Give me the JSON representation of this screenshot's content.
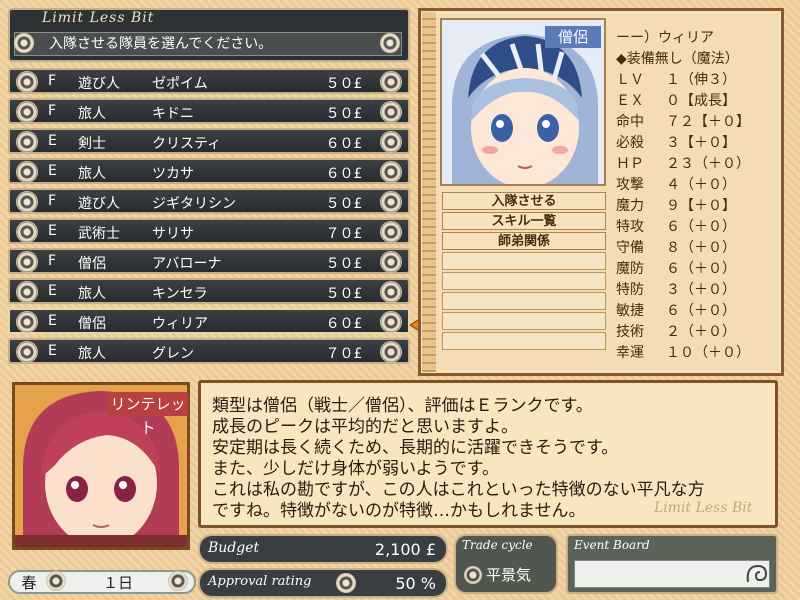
{
  "header": {
    "logo": "Limit Less Bit",
    "prompt": "入隊させる隊員を選んでください。"
  },
  "recruits": [
    {
      "rank": "F",
      "class": "遊び人",
      "name": "ゼポイム",
      "price": "５０£"
    },
    {
      "rank": "F",
      "class": "旅人",
      "name": "キドニ",
      "price": "５０£"
    },
    {
      "rank": "E",
      "class": "剣士",
      "name": "クリスティ",
      "price": "６０£"
    },
    {
      "rank": "E",
      "class": "旅人",
      "name": "ツカサ",
      "price": "６０£"
    },
    {
      "rank": "F",
      "class": "遊び人",
      "name": "ジギタリシン",
      "price": "５０£"
    },
    {
      "rank": "E",
      "class": "武術士",
      "name": "サリサ",
      "price": "７０£"
    },
    {
      "rank": "F",
      "class": "僧侶",
      "name": "アバローナ",
      "price": "５０£"
    },
    {
      "rank": "E",
      "class": "旅人",
      "name": "キンセラ",
      "price": "５０£"
    },
    {
      "rank": "E",
      "class": "僧侶",
      "name": "ウィリア",
      "price": "６０£"
    },
    {
      "rank": "E",
      "class": "旅人",
      "name": "グレン",
      "price": "７０£"
    }
  ],
  "selected": {
    "class_badge": "僧侶",
    "name_line": "ーー）ウィリア",
    "equip_line": "◆装備無し（魔法）",
    "stats": [
      {
        "label": "ＬＶ",
        "value": "１（伸３）"
      },
      {
        "label": "ＥＸ",
        "value": "０【成長】"
      },
      {
        "label": "命中",
        "value": "７２【＋０】"
      },
      {
        "label": "必殺",
        "value": "３【＋０】"
      },
      {
        "label": "ＨＰ",
        "value": "２３（＋０）"
      },
      {
        "label": "攻撃",
        "value": "４（＋０）"
      },
      {
        "label": "魔力",
        "value": "９【＋０】"
      },
      {
        "label": "特攻",
        "value": "６（＋０）"
      },
      {
        "label": "守備",
        "value": "８（＋０）"
      },
      {
        "label": "魔防",
        "value": "６（＋０）"
      },
      {
        "label": "特防",
        "value": "３（＋０）"
      },
      {
        "label": "敏捷",
        "value": "６（＋０）"
      },
      {
        "label": "技術",
        "value": "２（＋０）"
      },
      {
        "label": "幸運",
        "value": "１０（＋０）"
      }
    ]
  },
  "menu": [
    {
      "label": "入隊させる"
    },
    {
      "label": "スキル一覧"
    },
    {
      "label": "師弟関係"
    }
  ],
  "advisor": {
    "name": "リンテレット"
  },
  "message": {
    "lines": [
      "類型は僧侶（戦士／僧侶）、評価はＥランクです。",
      "成長のピークは平均的だと思いますよ。",
      "安定期は長く続くため、長期的に活躍できそうです。",
      "また、少しだけ身体が弱いようです。",
      "これは私の勘ですが、この人はこれといった特徴のない平凡な方",
      "ですね。特徴がないのが特徴…かもしれません。"
    ],
    "watermark": "Limit Less Bit"
  },
  "status": {
    "season": "春",
    "day": "１日",
    "budget_label": "Budget",
    "budget_value": "2,100 £",
    "approval_label": "Approval rating",
    "approval_value": "50 %",
    "trade_label": "Trade cycle",
    "trade_value": "平景気",
    "event_label": "Event Board"
  },
  "colors": {
    "background": "#f1cf9c",
    "row_dark": "#2e3234",
    "frame_gold": "#c6b089",
    "class_badge": "#5a7ab8",
    "name_badge": "#b8403e"
  },
  "icons": {
    "row_ornament": "rosette-ornament-icon",
    "arrows": "orange-left-right-arrow-icon",
    "event_scroll": "scroll-curl-icon"
  }
}
